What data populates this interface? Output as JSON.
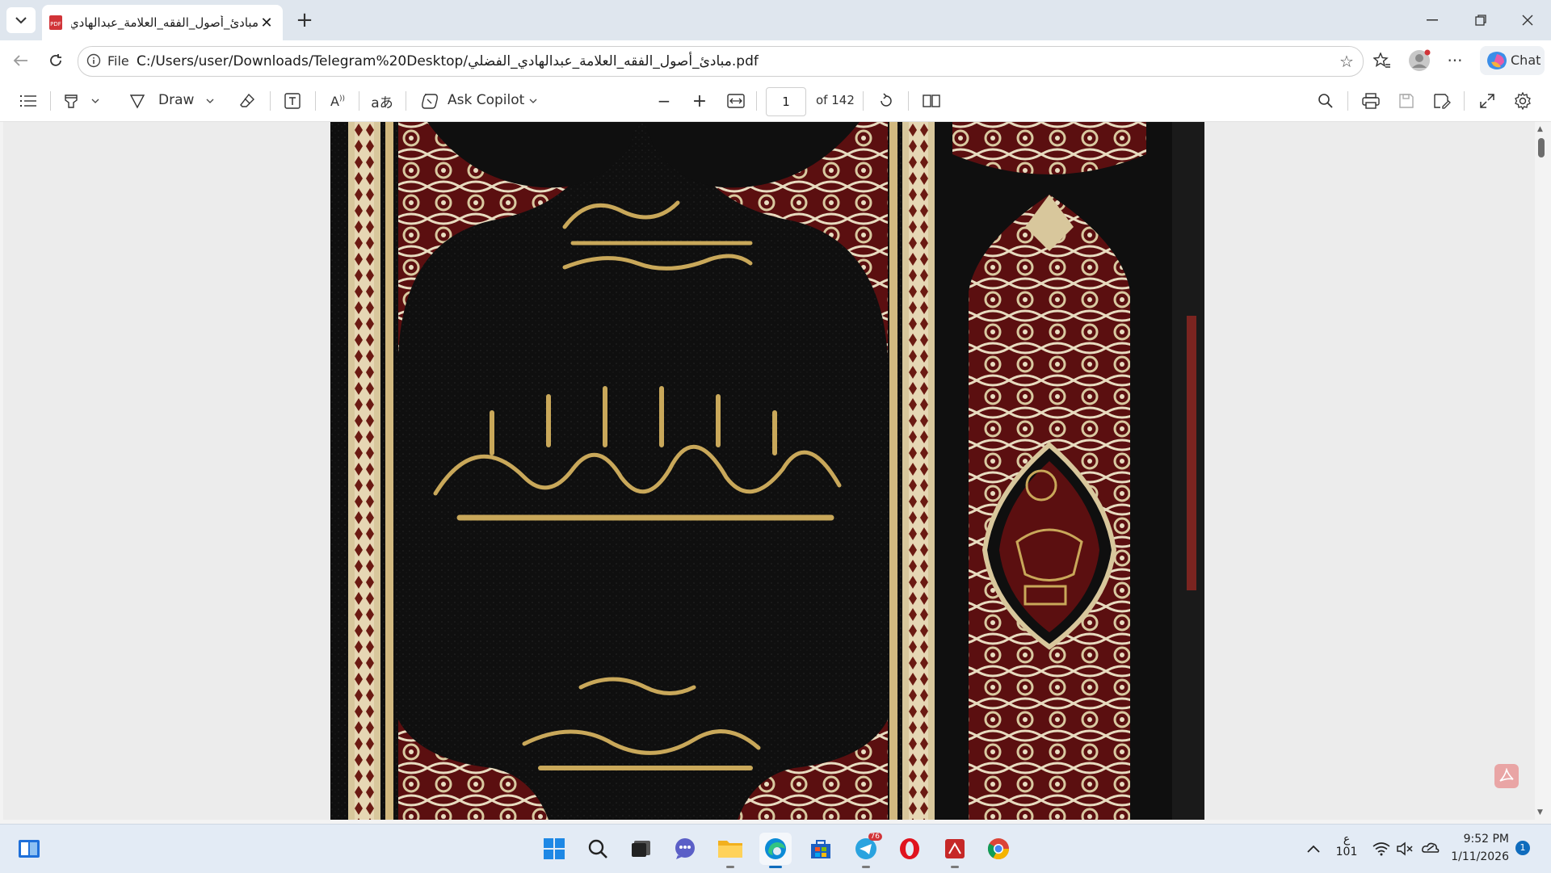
{
  "tab": {
    "title": "مبادئ_أصول_الفقه_العلامة_عبدالهادي",
    "favicon": "pdf-icon"
  },
  "omnibox": {
    "scheme_label": "File",
    "url": "C:/Users/user/Downloads/Telegram%20Desktop/مبادئ_أصول_الفقه_العلامة_عبدالهادي_الفضلي.pdf"
  },
  "chat": {
    "label": "Chat"
  },
  "pdf_toolbar": {
    "draw_label": "Draw",
    "copilot_label": "Ask Copilot",
    "page_value": "1",
    "page_total": "of 142"
  },
  "taskbar": {
    "lang_top": "ع",
    "lang_bottom": "101",
    "time": "9:52 PM",
    "date": "1/11/2026",
    "notification_count": "1",
    "telegram_badge": "76"
  },
  "colors": {
    "accent": "#0f6cbd",
    "cover_black": "#0c0c0c",
    "cover_maroon": "#5b0f10",
    "cover_gold": "#c9a85a"
  }
}
